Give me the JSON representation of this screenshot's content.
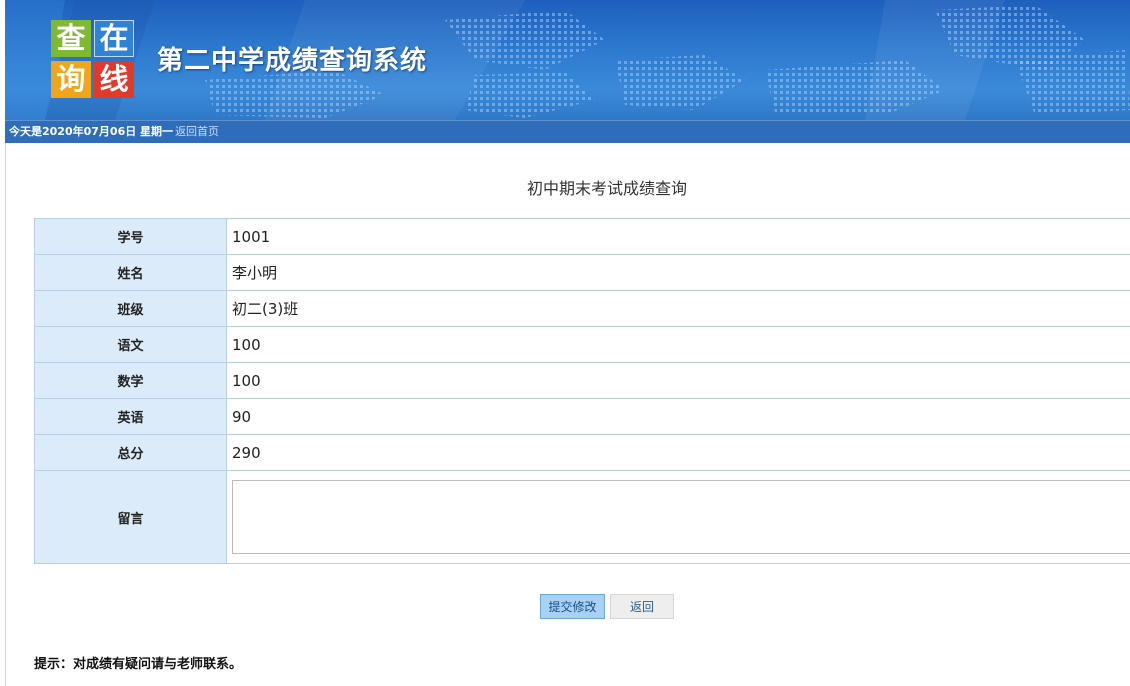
{
  "header": {
    "logo_chars": [
      "查",
      "在",
      "询",
      "线"
    ],
    "site_title": "第二中学成绩查询系统"
  },
  "datebar": {
    "date_text": "今天是2020年07月06日 星期一",
    "home_link": "返回首页"
  },
  "form": {
    "title": "初中期末考试成绩查询",
    "rows": [
      {
        "label": "学号",
        "value": "1001"
      },
      {
        "label": "姓名",
        "value": "李小明"
      },
      {
        "label": "班级",
        "value": "初二(3)班"
      },
      {
        "label": "语文",
        "value": "100"
      },
      {
        "label": "数学",
        "value": "100"
      },
      {
        "label": "英语",
        "value": "90"
      },
      {
        "label": "总分",
        "value": "290"
      }
    ],
    "message_label": "留言",
    "message_value": ""
  },
  "buttons": {
    "submit_label": "提交修改",
    "back_label": "返回"
  },
  "tip": "提示：对成绩有疑问请与老师联系。",
  "colors": {
    "banner": "#2d79cf",
    "datebar": "#2f6dbb",
    "label_cell_bg": "#dbebf9",
    "table_border": "#b7d0e6",
    "submit_button_bg": "#a8d1f3"
  }
}
